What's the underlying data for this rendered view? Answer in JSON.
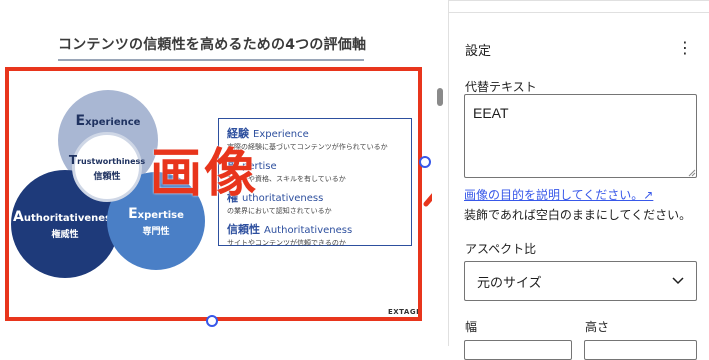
{
  "slide": {
    "title": "コンテンツの信頼性を高めるための4つの評価軸",
    "overlay_text": "画像",
    "brand": "EXTAGE",
    "circles": {
      "experience": {
        "initial": "E",
        "rest": "xperience",
        "jp": "経験"
      },
      "authoritativeness": {
        "initial": "A",
        "rest": "uthoritativeness",
        "jp": "権威性"
      },
      "expertise": {
        "initial": "E",
        "rest": "xpertise",
        "jp": "専門性"
      },
      "trustworthiness": {
        "initial": "T",
        "rest": "rustworthiness",
        "jp": "信頼性"
      }
    },
    "descriptions": [
      {
        "jp": "経験",
        "en": "Experience",
        "text": "実際の経験に基づいてコンテンツが作られているか"
      },
      {
        "jp": "専",
        "en": "pertise",
        "text": "な知識や資格、スキルを有しているか"
      },
      {
        "jp": "権",
        "en": "uthoritativeness",
        "text": "の業界において認知されているか"
      },
      {
        "jp": "信頼性",
        "en": "Authoritativeness",
        "text": "サイトやコンテンツが信頼できるのか"
      }
    ]
  },
  "sidebar": {
    "panel_title": "設定",
    "more_icon": "⋮",
    "alt_label": "代替テキスト",
    "alt_value": "EEAT",
    "alt_link": "画像の目的を説明してください。↗",
    "alt_help": "装飾であれば空白のままにしてください。",
    "aspect_label": "アスペクト比",
    "aspect_value": "元のサイズ",
    "width_label": "幅",
    "height_label": "高さ"
  },
  "colors": {
    "accent_red": "#e8351c",
    "wp_blue": "#3858e9",
    "navy": "#1e3a7a"
  }
}
